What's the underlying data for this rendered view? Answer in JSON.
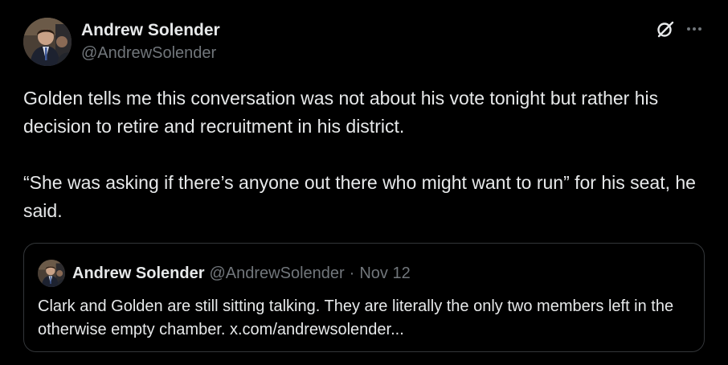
{
  "tweet": {
    "author": {
      "name": "Andrew Solender",
      "handle": "@AndrewSolender"
    },
    "text": [
      "Golden tells me this conversation was not about his vote tonight but rather his decision to retire and recruitment in his district.",
      "“She was asking if there’s anyone out there who might want to run” for his seat, he said."
    ]
  },
  "quote": {
    "name": "Andrew Solender",
    "handle": "@AndrewSolender",
    "separator": "·",
    "date": "Nov 12",
    "text": "Clark and Golden are still sitting talking. They are literally the only two members left in the otherwise empty chamber. x.com/andrewsolender..."
  },
  "icons": {
    "grok": "grok-icon",
    "more": "more-icon",
    "avatar": "avatar"
  },
  "colors": {
    "background": "#000000",
    "text": "#e7e9ea",
    "secondary": "#71767b",
    "border": "#333639"
  }
}
